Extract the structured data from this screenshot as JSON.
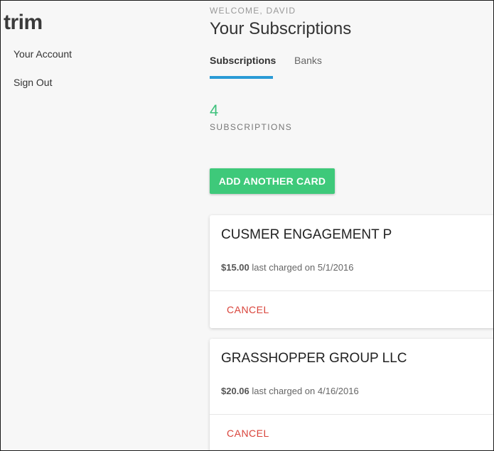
{
  "sidebar": {
    "logo": "trim",
    "items": [
      {
        "label": "Your Account"
      },
      {
        "label": "Sign Out"
      }
    ]
  },
  "header": {
    "welcome": "WELCOME, DAVID",
    "title": "Your Subscriptions"
  },
  "tabs": [
    {
      "label": "Subscriptions",
      "active": true
    },
    {
      "label": "Banks",
      "active": false
    }
  ],
  "summary": {
    "count": "4",
    "label": "SUBSCRIPTIONS"
  },
  "add_card_label": "ADD ANOTHER CARD",
  "subscriptions": [
    {
      "name": "CUSMER ENGAGEMENT P",
      "amount": "$15.00",
      "charged_text": " last charged on 5/1/2016",
      "cancel_label": "CANCEL"
    },
    {
      "name": "GRASSHOPPER GROUP LLC",
      "amount": "$20.06",
      "charged_text": " last charged on 4/16/2016",
      "cancel_label": "CANCEL"
    }
  ],
  "colors": {
    "accent_blue": "#2a9bd6",
    "accent_green": "#3ec97a",
    "count_green": "#3ec17c",
    "cancel_red": "#d9433a"
  }
}
